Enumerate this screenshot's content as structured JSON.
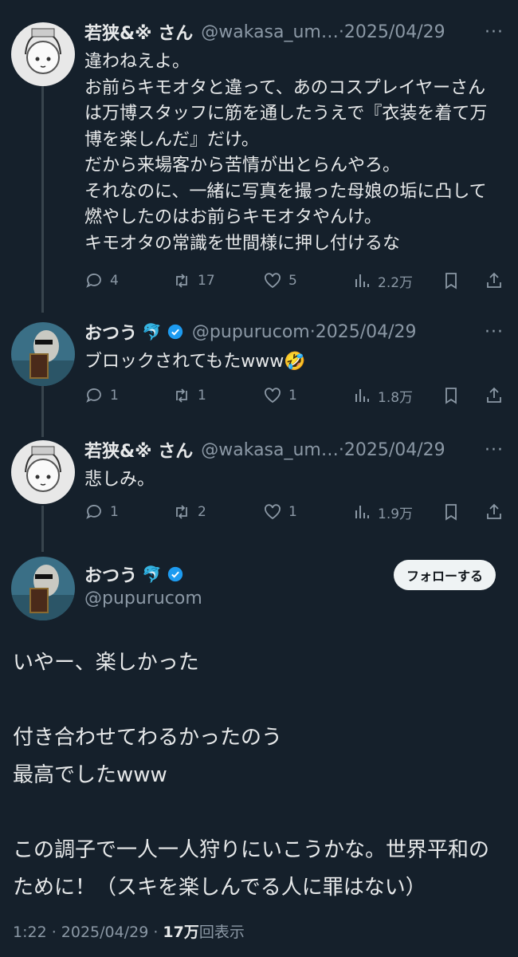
{
  "tweets": [
    {
      "name": "若狭&※ さん",
      "handle": "@wakasa_um…",
      "sep": "·",
      "date": "2025/04/29",
      "text": "違わねえよ。\nお前らキモオタと違って、あのコスプレイヤーさんは万博スタッフに筋を通したうえで『衣装を着て万博を楽しんだ』だけ。\nだから来場客から苦情が出とらんやろ。\nそれなのに、一緒に写真を撮った母娘の垢に凸して燃やしたのはお前らキモオタやんけ。\nキモオタの常識を世間様に押し付けるな",
      "replies": "4",
      "retweets": "17",
      "likes": "5",
      "views": "2.2万"
    },
    {
      "name": "おつう",
      "emoji": "🐬",
      "handle": "@pupurucom",
      "sep": "·",
      "date": "2025/04/29",
      "text": "ブロックされてもたwww🤣",
      "replies": "1",
      "retweets": "1",
      "likes": "1",
      "views": "1.8万"
    },
    {
      "name": "若狭&※ さん",
      "handle": "@wakasa_um…",
      "sep": "·",
      "date": "2025/04/29",
      "text": "悲しみ。",
      "replies": "1",
      "retweets": "2",
      "likes": "1",
      "views": "1.9万"
    }
  ],
  "main": {
    "name": "おつう",
    "emoji": "🐬",
    "handle": "@pupurucom",
    "follow_label": "フォローする",
    "text": "いやー、楽しかった\n\n付き合わせてわるかったのう\n最高でしたwww\n\nこの調子で一人一人狩りにいこうかな。世界平和のために！（スキを楽しんでる人に罪はない）",
    "time": "1:22 · 2025/04/29 · ",
    "views_count": "17万",
    "views_label": "回表示"
  },
  "icons": [
    "reply-icon",
    "retweet-icon",
    "like-icon",
    "views-icon",
    "bookmark-icon",
    "share-icon",
    "verified-icon",
    "more-icon"
  ],
  "colors": {
    "background": "#15202b",
    "text": "#e7e9ea",
    "muted": "#8b98a5",
    "verified": "#1d9bf0",
    "thread_line": "#38444d"
  }
}
